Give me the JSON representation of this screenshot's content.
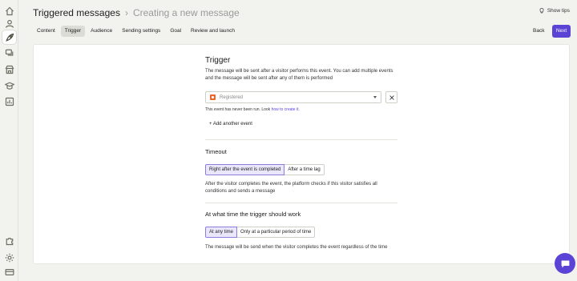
{
  "sidebar": {
    "items": [
      {
        "name": "home-icon"
      },
      {
        "name": "user-icon"
      },
      {
        "name": "rocket-icon",
        "active": true
      },
      {
        "name": "messages-icon"
      },
      {
        "name": "store-icon"
      },
      {
        "name": "graduation-cap-icon"
      },
      {
        "name": "reports-icon"
      }
    ],
    "bottom_items": [
      {
        "name": "puzzle-icon"
      },
      {
        "name": "settings-gear-icon"
      },
      {
        "name": "billing-card-icon"
      }
    ]
  },
  "header": {
    "title": "Triggered messages",
    "separator": "›",
    "subtitle": "Creating a new message",
    "show_tips": "Show tips"
  },
  "tabs": [
    {
      "label": "Content",
      "active": false
    },
    {
      "label": "Trigger",
      "active": true
    },
    {
      "label": "Audience",
      "active": false
    },
    {
      "label": "Sending settings",
      "active": false
    },
    {
      "label": "Goal",
      "active": false
    },
    {
      "label": "Review and launch",
      "active": false
    }
  ],
  "nav": {
    "back_label": "Back",
    "next_label": "Next"
  },
  "trigger": {
    "title": "Trigger",
    "description": "The message will be sent after a visitor performs this event. You can add multiple events and the message will be sent after any of them is performed",
    "event_select": {
      "value": "Registered"
    },
    "never_run_text": "This event has never been run. Look ",
    "never_run_link": "how to create it.",
    "add_event_label": "+ Add another event"
  },
  "timeout": {
    "title": "Timeout",
    "options": [
      "Right after the event is completed",
      "After a time lag"
    ],
    "selected": "Right after the event is completed",
    "description": "After the visitor completes the event, the platform checks if this visitor satisfies all conditions and sends a message"
  },
  "time_window": {
    "title": "At what time the trigger should work",
    "options": [
      "At any time",
      "Only at a particular period of time"
    ],
    "selected": "At any time",
    "description": "The message will be send when the visitor completes the event regardless of the time"
  },
  "colors": {
    "accent": "#5b43d6",
    "event_badge": "#f06428",
    "selected_option_bg": "#ebe7fb"
  }
}
